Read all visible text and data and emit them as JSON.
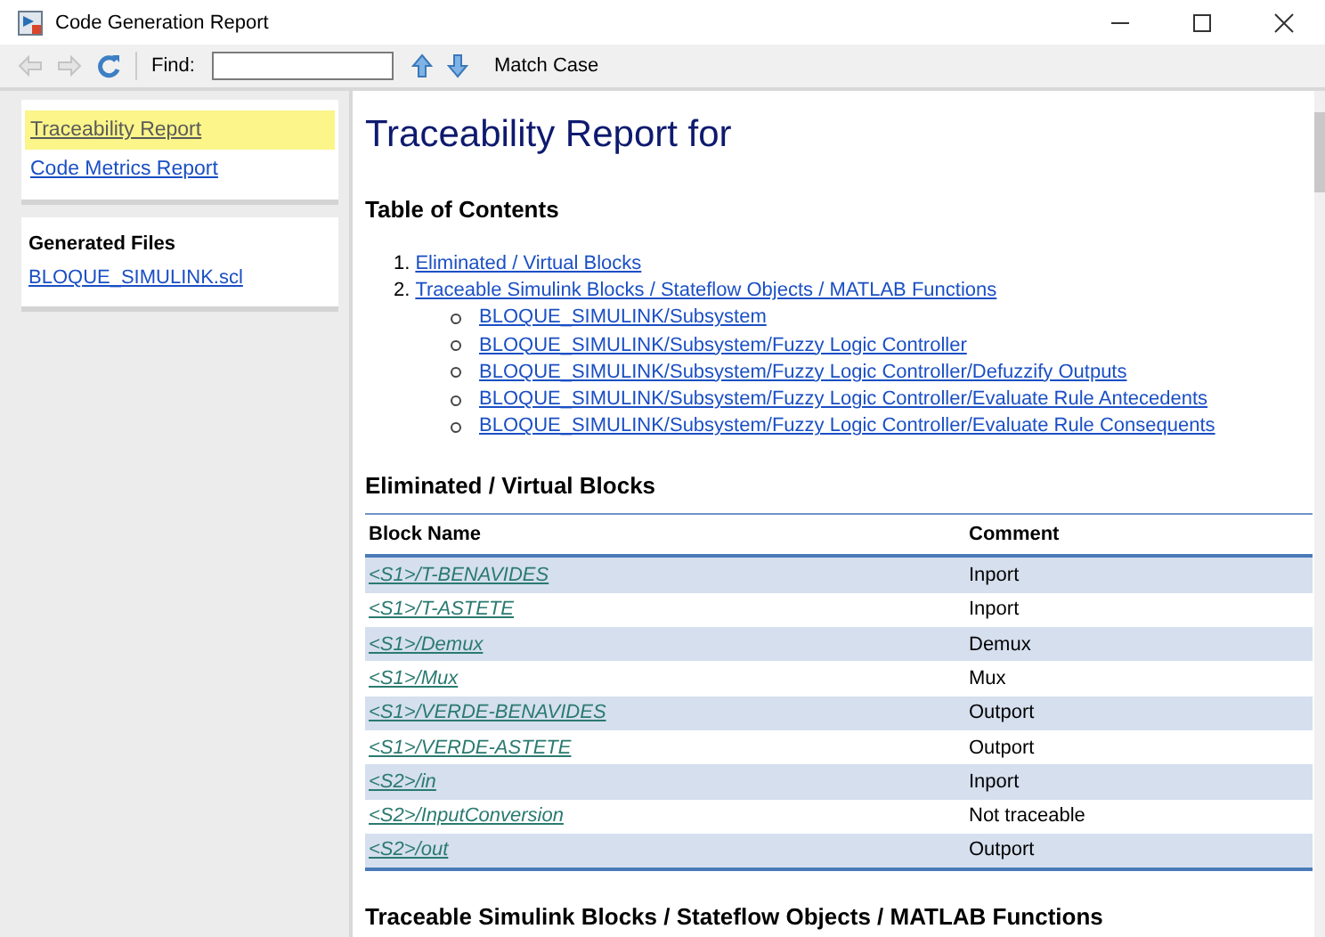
{
  "window": {
    "title": "Code Generation Report"
  },
  "toolbar": {
    "find_label": "Find:",
    "match_case": "Match Case"
  },
  "sidebar": {
    "reports": [
      {
        "label": "Traceability Report",
        "selected": true
      },
      {
        "label": "Code Metrics Report",
        "selected": false
      }
    ],
    "files_title": "Generated Files",
    "files": [
      "BLOQUE_SIMULINK.scl"
    ]
  },
  "content": {
    "title": "Traceability Report for",
    "toc_title": "Table of Contents",
    "toc": [
      {
        "number": "1.",
        "label": "Eliminated / Virtual Blocks"
      },
      {
        "number": "2.",
        "label": "Traceable Simulink Blocks / Stateflow Objects / MATLAB Functions",
        "children": [
          {
            "label": "BLOQUE_SIMULINK/Subsystem"
          },
          {
            "label": "BLOQUE_SIMULINK/Subsystem/Fuzzy Logic Controller"
          },
          {
            "label": "BLOQUE_SIMULINK/Subsystem/Fuzzy Logic Controller/Defuzzify Outputs"
          },
          {
            "label": "BLOQUE_SIMULINK/Subsystem/Fuzzy Logic Controller/Evaluate Rule Antecedents"
          },
          {
            "label": "BLOQUE_SIMULINK/Subsystem/Fuzzy Logic Controller/Evaluate Rule Consequents"
          }
        ]
      }
    ],
    "section_title": "Eliminated / Virtual Blocks",
    "table": {
      "columns": [
        "Block Name",
        "Comment"
      ],
      "rows": [
        [
          "<S1>/T-BENAVIDES",
          "Inport"
        ],
        [
          "<S1>/T-ASTETE",
          "Inport"
        ],
        [
          "<S1>/Demux",
          "Demux"
        ],
        [
          "<S1>/Mux",
          "Mux"
        ],
        [
          "<S1>/VERDE-BENAVIDES",
          "Outport"
        ],
        [
          "<S1>/VERDE-ASTETE",
          "Outport"
        ],
        [
          "<S2>/in",
          "Inport"
        ],
        [
          "<S2>/InputConversion",
          "Not traceable"
        ],
        [
          "<S2>/out",
          "Outport"
        ]
      ]
    },
    "section2_title": "Traceable Simulink Blocks / Stateflow Objects / MATLAB Functions"
  }
}
